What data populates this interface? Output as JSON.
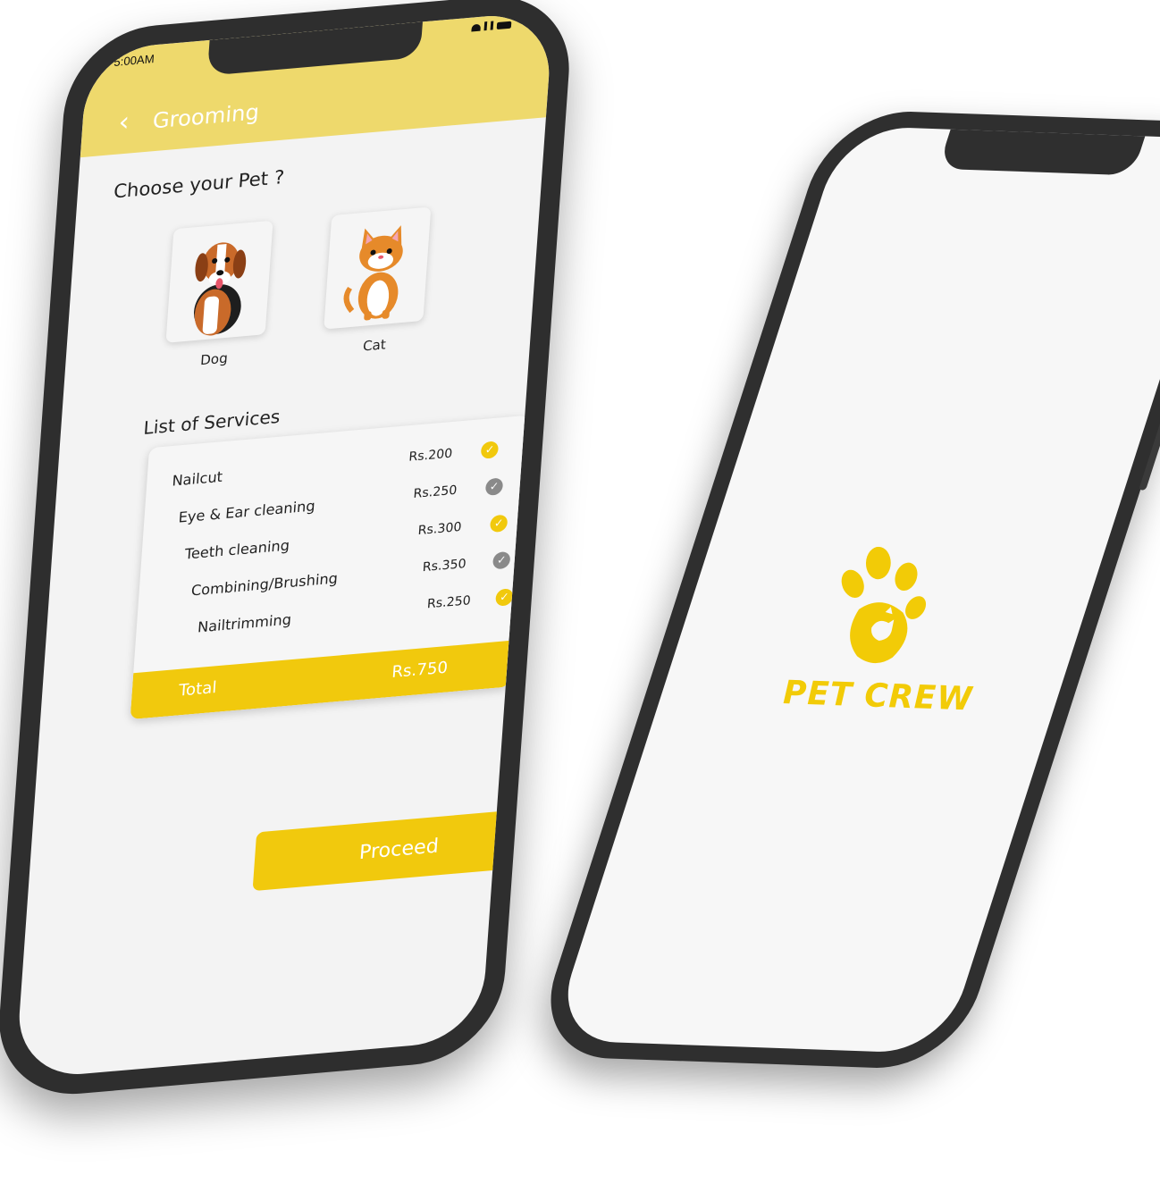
{
  "status_bar": {
    "time": "5:00AM"
  },
  "header": {
    "back_icon": "chevron-left-icon",
    "title": "Grooming"
  },
  "pet_section": {
    "title": "Choose your Pet ?",
    "pets": [
      {
        "label": "Dog",
        "icon": "dog-illustration"
      },
      {
        "label": "Cat",
        "icon": "cat-illustration"
      }
    ]
  },
  "services": {
    "title": "List of Services",
    "items": [
      {
        "name": "Nailcut",
        "price": "Rs.200",
        "selected": true
      },
      {
        "name": "Eye & Ear cleaning",
        "price": "Rs.250",
        "selected": false
      },
      {
        "name": "Teeth cleaning",
        "price": "Rs.300",
        "selected": true
      },
      {
        "name": "Combining/Brushing",
        "price": "Rs.350",
        "selected": false
      },
      {
        "name": "Nailtrimming",
        "price": "Rs.250",
        "selected": true
      }
    ],
    "total_label": "Total",
    "total_value": "Rs.750"
  },
  "proceed_label": "Proceed",
  "splash": {
    "brand": "PET CREW",
    "logo_icon": "paw-icon"
  },
  "colors": {
    "accent": "#f1c90d",
    "header": "#eed96c",
    "check_selected": "#f1c90d",
    "check_unselected": "#8a8a8a",
    "phone_frame": "#2e2e2e"
  }
}
